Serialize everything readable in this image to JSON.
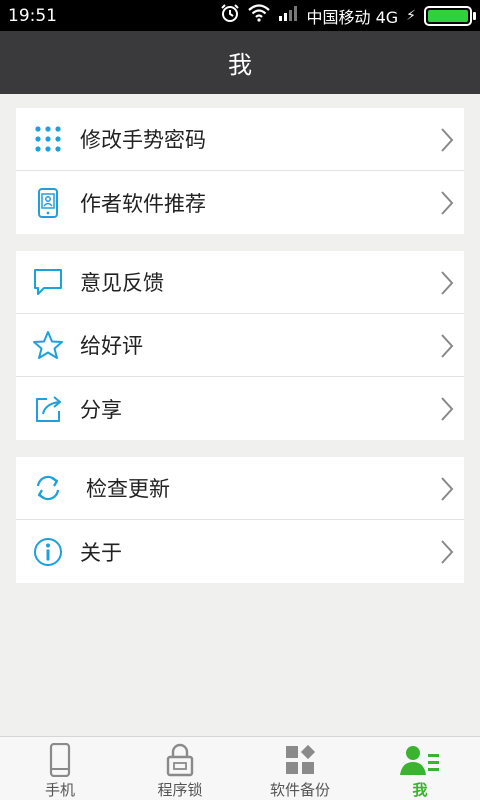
{
  "statusbar": {
    "time": "19:51",
    "carrier": "中国移动 4G",
    "battery_level": 1.0
  },
  "header": {
    "title": "我"
  },
  "groups": [
    {
      "items": [
        {
          "label": "修改手势密码",
          "icon": "dots-grid-icon"
        },
        {
          "label": "作者软件推荐",
          "icon": "phone-app-icon"
        }
      ]
    },
    {
      "items": [
        {
          "label": "意见反馈",
          "icon": "chat-bubble-icon"
        },
        {
          "label": "给好评",
          "icon": "star-icon"
        },
        {
          "label": "分享",
          "icon": "share-icon"
        }
      ]
    },
    {
      "items": [
        {
          "label": "检查更新",
          "icon": "refresh-icon"
        },
        {
          "label": "关于",
          "icon": "info-icon"
        }
      ]
    }
  ],
  "bottomnav": {
    "items": [
      {
        "label": "手机",
        "icon": "phone-icon"
      },
      {
        "label": "程序锁",
        "icon": "lock-icon"
      },
      {
        "label": "软件备份",
        "icon": "apps-icon"
      },
      {
        "label": "我",
        "icon": "user-list-icon",
        "active": true
      }
    ]
  },
  "colors": {
    "accent": "#1ea0dc",
    "nav_active": "#3bb32e",
    "titlebar": "#3a3a3c"
  }
}
